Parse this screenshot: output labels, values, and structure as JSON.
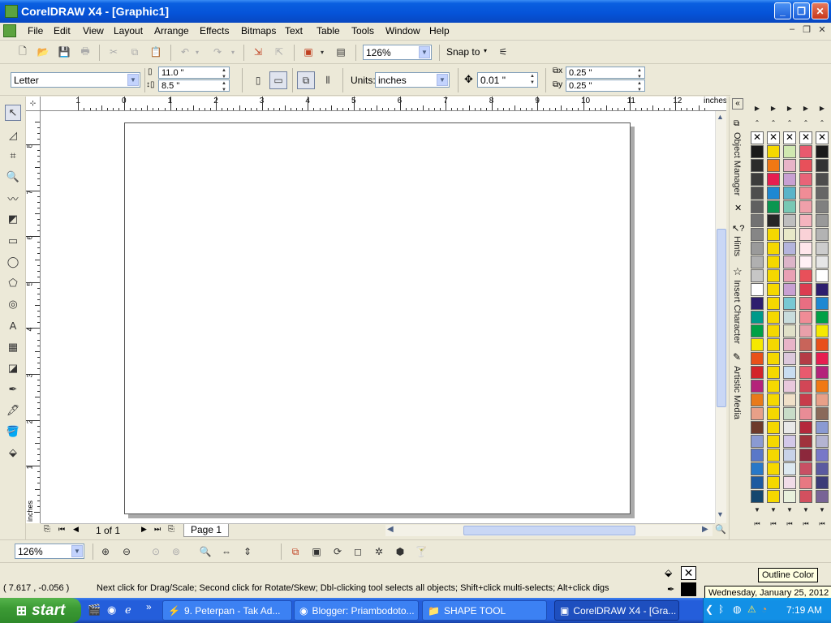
{
  "window": {
    "title": "CorelDRAW X4 - [Graphic1]",
    "buttons": {
      "minimize": "_",
      "maximize": "❐",
      "close": "✕"
    }
  },
  "menu": {
    "items": [
      "File",
      "Edit",
      "View",
      "Layout",
      "Arrange",
      "Effects",
      "Bitmaps",
      "Text",
      "Table",
      "Tools",
      "Window",
      "Help"
    ]
  },
  "standard_toolbar": {
    "zoom_value": "126%",
    "snap_label": "Snap to"
  },
  "property_bar": {
    "paper_type": "Letter",
    "paper_width": "11.0 \"",
    "paper_height": "8.5 \"",
    "units_label": "Units:",
    "units_value": "inches",
    "nudge_value": "0.01 \"",
    "duplicate_x": "0.25 \"",
    "duplicate_y": "0.25 \""
  },
  "rulers": {
    "horizontal_labels": [
      "1",
      "0",
      "1",
      "2",
      "3",
      "4",
      "5",
      "6",
      "7",
      "8",
      "9",
      "10",
      "11",
      "12"
    ],
    "horizontal_unit": "inches",
    "vertical_labels": [
      "8",
      "7",
      "6",
      "5",
      "4",
      "3",
      "2",
      "1"
    ],
    "vertical_unit": "inches"
  },
  "page_nav": {
    "page_count": "1 of 1",
    "page_tab": "Page 1"
  },
  "dockers": {
    "tabs": [
      "Object Manager",
      "Hints",
      "Insert Character",
      "Artistic Media"
    ]
  },
  "zoom_toolbar": {
    "zoom_value": "126%"
  },
  "status": {
    "coordinates": "( 7.617 , -0.056 )",
    "message": "Next click for Drag/Scale; Second click for Rotate/Skew; Dbl-clicking tool selects all objects; Shift+click multi-selects; Alt+click digs",
    "tooltip_outline": "Outline Color",
    "tooltip_date": "Wednesday, January 25, 2012",
    "outline_color": "#000000"
  },
  "taskbar": {
    "start_label": "start",
    "tasks": [
      {
        "label": "9. Peterpan - Tak Ad..."
      },
      {
        "label": "Blogger: Priambodoto..."
      },
      {
        "label": "SHAPE TOOL"
      },
      {
        "label": "CorelDRAW X4 - [Gra..."
      }
    ],
    "clock": "7:19 AM"
  },
  "palettes": [
    {
      "colors": [
        "#1a1a1a",
        "#2b2b2b",
        "#3c3c3c",
        "#4e4e4e",
        "#606060",
        "#727272",
        "#868686",
        "#9a9a9a",
        "#b0b0b0",
        "#c6c6c6",
        "#ffffff",
        "#2d1e6e",
        "#009a8a",
        "#00a046",
        "#f5e800",
        "#e8501a",
        "#d2232a",
        "#b4237a",
        "#e87a1a",
        "#e8a088",
        "#6e3a2a",
        "#8a9ad2",
        "#5a78c8",
        "#2878c8",
        "#1e5aa0",
        "#14466e"
      ]
    },
    {
      "colors": [
        "#f5d800",
        "#f07814",
        "#e61e50",
        "#1e88d2",
        "#0a9650",
        "#262626",
        "#f5d800",
        "#f5d800",
        "#f5d800",
        "#f5d800",
        "#f5d800",
        "#f5d800",
        "#f5d800",
        "#f5d800",
        "#f5d800",
        "#f5d800",
        "#f5d800",
        "#f5d800",
        "#f5d800",
        "#f5d800",
        "#f5d800",
        "#f5d800",
        "#f5d800",
        "#f5d800",
        "#f5d800",
        "#f5d800"
      ]
    },
    {
      "colors": [
        "#d0e8b0",
        "#e8b4c8",
        "#c8a0d2",
        "#5ab4c8",
        "#78c8b4",
        "#bebebe",
        "#e8e8c8",
        "#b4b4dc",
        "#dcb4c8",
        "#e8a0b4",
        "#c8a0d2",
        "#78c8d2",
        "#c8dcdc",
        "#e0e0c8",
        "#e8b4c8",
        "#dcc8dc",
        "#c8dcf0",
        "#e8c8dc",
        "#f0e0c8",
        "#c8dcc8",
        "#e8e8e8",
        "#d2c8e8",
        "#c8d2e8",
        "#dce8f0",
        "#f0dce8",
        "#e8f0dc"
      ]
    },
    {
      "colors": [
        "#e85a6e",
        "#e8505a",
        "#e86478",
        "#f08c96",
        "#f0a0aa",
        "#f5b4be",
        "#fad2d7",
        "#ffe6eb",
        "#fff0f5",
        "#e8505a",
        "#dc3c50",
        "#e86e82",
        "#f08c96",
        "#e8a0aa",
        "#c8645a",
        "#b43c46",
        "#e85a6e",
        "#d24656",
        "#c83c4b",
        "#e88c96",
        "#b4283c",
        "#a0323c",
        "#8c283c",
        "#c85064",
        "#e87882",
        "#d2505f"
      ]
    },
    {
      "colors": [
        "#1a1a1a",
        "#333333",
        "#4d4d4d",
        "#666666",
        "#808080",
        "#999999",
        "#b3b3b3",
        "#cccccc",
        "#e6e6e6",
        "#ffffff",
        "#2d1e6e",
        "#1e88d2",
        "#00a046",
        "#f5e800",
        "#e8501a",
        "#e61e50",
        "#b4237a",
        "#f07814",
        "#e8a088",
        "#8a6a5a",
        "#8a9ad2",
        "#b4b4d2",
        "#7878c8",
        "#5a5aa0",
        "#3c3c78",
        "#786496"
      ]
    }
  ]
}
